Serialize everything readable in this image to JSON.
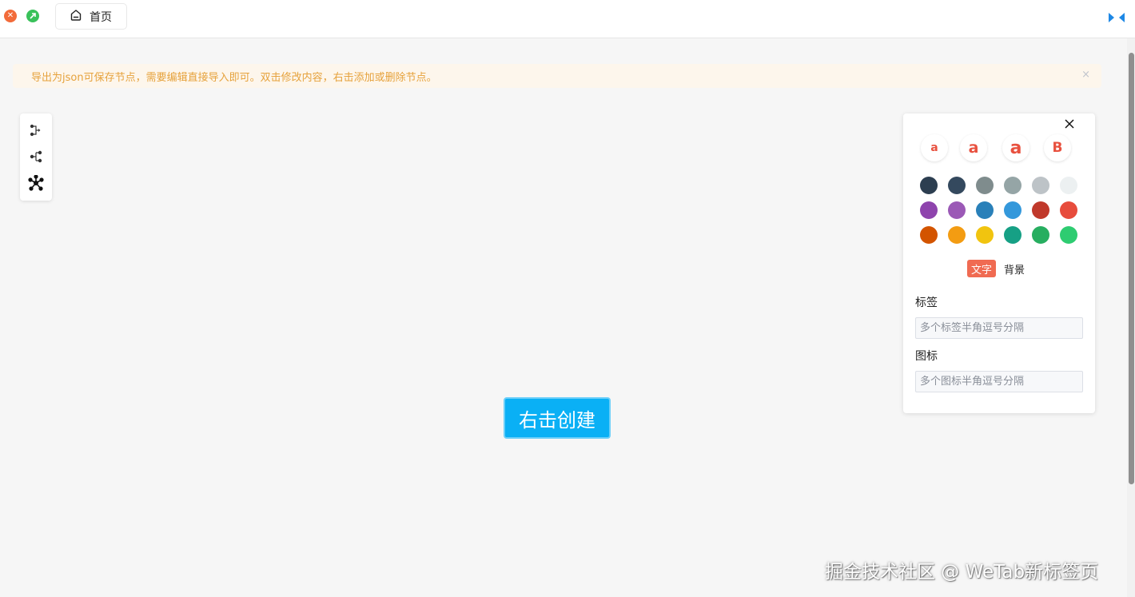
{
  "window": {
    "close_icon": "close-circle-icon",
    "maximize_icon": "expand-circle-icon",
    "tab": {
      "icon": "home-icon",
      "label": "首页"
    },
    "right_icon": "split-arrows-icon"
  },
  "alert": {
    "message": "导出为json可保存节点，需要编辑直接导入即可。双击修改内容，右击添加或删除节点。",
    "close": "×",
    "color": "#e6a23c"
  },
  "layout_toolbar": {
    "buttons": [
      {
        "icon": "layout-logical-icon"
      },
      {
        "icon": "layout-tree-icon"
      },
      {
        "icon": "layout-radial-icon"
      }
    ]
  },
  "canvas": {
    "center_node": {
      "label": "右击创建",
      "color": "#0ab0f5"
    }
  },
  "style_panel": {
    "close_icon": "close-icon",
    "font_buttons": [
      {
        "glyph": "a",
        "style": "small"
      },
      {
        "glyph": "a",
        "style": "medium"
      },
      {
        "glyph": "a",
        "style": "large"
      },
      {
        "glyph": "B",
        "style": "bold"
      }
    ],
    "colors": [
      "#2c3e50",
      "#34495e",
      "#7f8c8d",
      "#95a5a6",
      "#bdc3c7",
      "#ecf0f1",
      "#8e44ad",
      "#9b59b6",
      "#2980b9",
      "#3498db",
      "#c0392b",
      "#e74c3c",
      "#d35400",
      "#f39c12",
      "#f1c40f",
      "#16a085",
      "#27ae60",
      "#2ecc71"
    ],
    "color_target": {
      "text": "文字",
      "background": "背景",
      "active": "text"
    },
    "tags": {
      "label": "标签",
      "placeholder": "多个标签半角逗号分隔",
      "value": ""
    },
    "icons": {
      "label": "图标",
      "placeholder": "多个图标半角逗号分隔",
      "value": ""
    }
  },
  "watermark": "掘金技术社区 @ WeTab新标签页"
}
